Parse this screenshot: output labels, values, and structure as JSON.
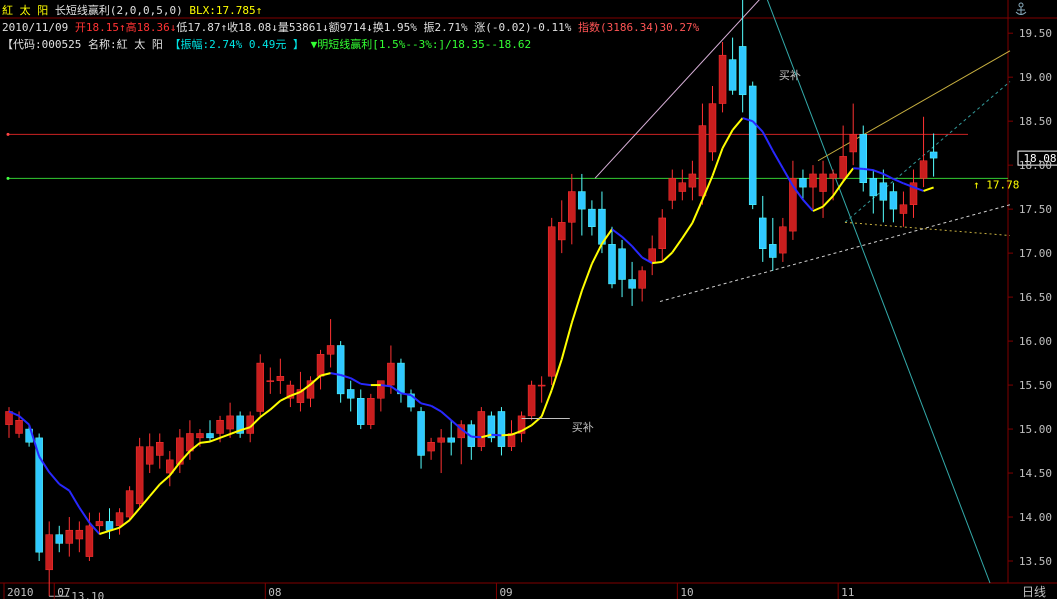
{
  "header": {
    "stock_name": "紅 太 阳",
    "indicator": "长短线赢利(2,0,0,5,0)",
    "blx": "BLX:17.785↑",
    "date": "2010/11/09",
    "open": "开18.15↑",
    "high": "高18.36↓",
    "low": "低17.87↑",
    "close": "收18.08↓",
    "volume": "量53861↓",
    "amount": "额9714↓",
    "turnover": "换1.95%",
    "amplitude": "振2.71%",
    "change": "涨(-0.02)-0.11%",
    "index": "指数(3186.34)30.27%",
    "code_label": "【代码:000525",
    "name_label": "名称:紅 太 阳",
    "zhenfu": "【振幅:2.74% 0.49元 】",
    "mingduan": "▼明短线赢利[1.5%--3%:]/18.35--18.62"
  },
  "corner_icon": "anchor-icon",
  "chart_data": {
    "type": "candlestick",
    "ylim": [
      13.25,
      19.65
    ],
    "yticks": [
      "19.50",
      "19.00",
      "18.50",
      "18.00",
      "17.50",
      "17.00",
      "16.50",
      "16.00",
      "15.50",
      "15.00",
      "14.50",
      "14.00",
      "13.50"
    ],
    "xticks": [
      {
        "label": "2010",
        "index": 0
      },
      {
        "label": "07",
        "index": 5
      },
      {
        "label": "08",
        "index": 26
      },
      {
        "label": "09",
        "index": 49
      },
      {
        "label": "10",
        "index": 67
      },
      {
        "label": "11",
        "index": 83
      }
    ],
    "period_label": "日线",
    "annotations": {
      "high": "19.95",
      "low": "13.10",
      "last_price": "18.08",
      "ma_last": "17.78",
      "buy_mark_1": "买补",
      "buy_mark_2": "买补"
    },
    "hlines": [
      18.35,
      17.85
    ],
    "candles": [
      [
        15.05,
        15.2,
        14.9,
        15.25
      ],
      [
        14.95,
        15.1,
        14.9,
        15.2
      ],
      [
        15.0,
        14.85,
        14.8,
        15.05
      ],
      [
        14.9,
        13.6,
        13.5,
        14.95
      ],
      [
        13.4,
        13.8,
        13.1,
        13.95
      ],
      [
        13.8,
        13.7,
        13.6,
        13.9
      ],
      [
        13.7,
        13.85,
        13.55,
        14.0
      ],
      [
        13.75,
        13.85,
        13.6,
        13.95
      ],
      [
        13.55,
        13.9,
        13.5,
        14.05
      ],
      [
        13.9,
        13.95,
        13.8,
        14.05
      ],
      [
        13.95,
        13.85,
        13.75,
        14.1
      ],
      [
        13.9,
        14.05,
        13.8,
        14.1
      ],
      [
        14.0,
        14.3,
        13.95,
        14.35
      ],
      [
        14.15,
        14.8,
        14.1,
        14.9
      ],
      [
        14.6,
        14.8,
        14.5,
        14.95
      ],
      [
        14.7,
        14.85,
        14.55,
        14.95
      ],
      [
        14.5,
        14.65,
        14.35,
        14.75
      ],
      [
        14.6,
        14.9,
        14.5,
        15.0
      ],
      [
        14.75,
        14.95,
        14.65,
        15.1
      ],
      [
        14.9,
        14.95,
        14.8,
        15.0
      ],
      [
        14.95,
        14.9,
        14.85,
        15.1
      ],
      [
        14.95,
        15.1,
        14.85,
        15.15
      ],
      [
        15.0,
        15.15,
        14.9,
        15.3
      ],
      [
        15.15,
        14.95,
        14.9,
        15.2
      ],
      [
        14.95,
        15.15,
        14.85,
        15.2
      ],
      [
        15.2,
        15.75,
        15.15,
        15.85
      ],
      [
        15.55,
        15.55,
        15.4,
        15.7
      ],
      [
        15.55,
        15.6,
        15.4,
        15.8
      ],
      [
        15.35,
        15.5,
        15.25,
        15.55
      ],
      [
        15.3,
        15.45,
        15.2,
        15.65
      ],
      [
        15.35,
        15.55,
        15.25,
        15.6
      ],
      [
        15.6,
        15.85,
        15.45,
        15.9
      ],
      [
        15.85,
        15.95,
        15.7,
        16.25
      ],
      [
        15.95,
        15.4,
        15.3,
        16.0
      ],
      [
        15.45,
        15.35,
        15.2,
        15.55
      ],
      [
        15.35,
        15.05,
        15.0,
        15.45
      ],
      [
        15.05,
        15.35,
        15.0,
        15.4
      ],
      [
        15.35,
        15.55,
        15.2,
        15.55
      ],
      [
        15.5,
        15.75,
        15.4,
        15.95
      ],
      [
        15.75,
        15.4,
        15.3,
        15.8
      ],
      [
        15.4,
        15.25,
        15.2,
        15.45
      ],
      [
        15.2,
        14.7,
        14.55,
        15.25
      ],
      [
        14.75,
        14.85,
        14.65,
        14.9
      ],
      [
        14.85,
        14.9,
        14.5,
        15.0
      ],
      [
        14.9,
        14.85,
        14.7,
        15.1
      ],
      [
        14.9,
        15.05,
        14.6,
        15.1
      ],
      [
        15.05,
        14.8,
        14.65,
        15.1
      ],
      [
        14.8,
        15.2,
        14.75,
        15.25
      ],
      [
        15.15,
        14.9,
        14.85,
        15.2
      ],
      [
        15.2,
        14.8,
        14.7,
        15.25
      ],
      [
        14.8,
        14.95,
        14.75,
        15.1
      ],
      [
        14.95,
        15.15,
        14.85,
        15.2
      ],
      [
        15.15,
        15.5,
        15.1,
        15.55
      ],
      [
        15.5,
        15.5,
        15.3,
        15.6
      ],
      [
        15.6,
        17.3,
        15.5,
        17.4
      ],
      [
        17.15,
        17.35,
        17.0,
        17.6
      ],
      [
        17.35,
        17.7,
        17.1,
        17.9
      ],
      [
        17.7,
        17.5,
        17.2,
        17.9
      ],
      [
        17.5,
        17.3,
        17.2,
        17.6
      ],
      [
        17.5,
        17.1,
        17.0,
        17.7
      ],
      [
        17.1,
        16.65,
        16.6,
        17.3
      ],
      [
        17.05,
        16.7,
        16.5,
        17.15
      ],
      [
        16.7,
        16.6,
        16.4,
        16.9
      ],
      [
        16.6,
        16.8,
        16.45,
        16.85
      ],
      [
        16.9,
        17.05,
        16.75,
        17.2
      ],
      [
        17.05,
        17.4,
        16.9,
        17.5
      ],
      [
        17.6,
        17.85,
        17.5,
        17.95
      ],
      [
        17.7,
        17.8,
        17.6,
        17.95
      ],
      [
        17.75,
        17.9,
        17.6,
        18.05
      ],
      [
        17.65,
        18.45,
        17.55,
        18.7
      ],
      [
        18.15,
        18.7,
        18.05,
        18.9
      ],
      [
        18.7,
        19.25,
        18.6,
        19.4
      ],
      [
        19.2,
        18.85,
        18.8,
        19.45
      ],
      [
        19.35,
        18.8,
        18.6,
        19.95
      ],
      [
        18.9,
        17.55,
        17.5,
        18.95
      ],
      [
        17.4,
        17.05,
        16.9,
        17.65
      ],
      [
        17.1,
        16.95,
        16.8,
        17.4
      ],
      [
        17.0,
        17.3,
        16.9,
        17.4
      ],
      [
        17.25,
        17.85,
        17.15,
        18.05
      ],
      [
        17.85,
        17.75,
        17.6,
        17.95
      ],
      [
        17.75,
        17.9,
        17.5,
        18.0
      ],
      [
        17.7,
        17.9,
        17.4,
        18.05
      ],
      [
        17.85,
        17.9,
        17.6,
        17.95
      ],
      [
        17.85,
        18.1,
        17.8,
        18.45
      ],
      [
        18.15,
        18.35,
        18.0,
        18.7
      ],
      [
        18.35,
        17.8,
        17.7,
        18.45
      ],
      [
        17.85,
        17.65,
        17.45,
        17.95
      ],
      [
        17.8,
        17.6,
        17.35,
        17.95
      ],
      [
        17.7,
        17.5,
        17.35,
        17.8
      ],
      [
        17.45,
        17.55,
        17.3,
        17.7
      ],
      [
        17.55,
        17.8,
        17.4,
        17.95
      ],
      [
        17.85,
        18.05,
        17.75,
        18.55
      ],
      [
        18.15,
        18.08,
        17.87,
        18.36
      ]
    ]
  }
}
